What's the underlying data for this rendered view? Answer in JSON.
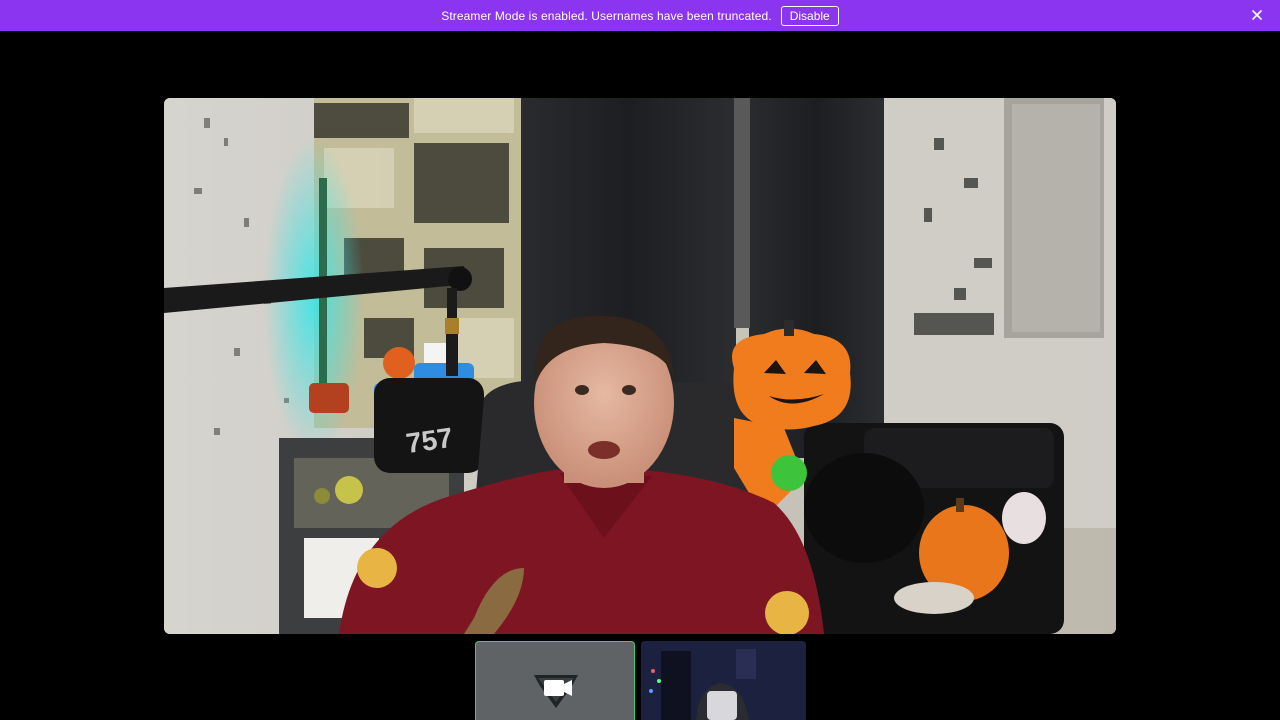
{
  "banner": {
    "message": "Streamer Mode is enabled. Usernames have been truncated.",
    "disable_label": "Disable",
    "close_icon": "close-icon",
    "color": "#8c35f0"
  },
  "main_video": {
    "mic_logo_text": "757"
  },
  "thumbnails": [
    {
      "kind": "camera-placeholder",
      "icon": "video-camera-icon",
      "active": true,
      "border_color": "#3bd16a"
    },
    {
      "kind": "video-feed",
      "active": false
    }
  ]
}
